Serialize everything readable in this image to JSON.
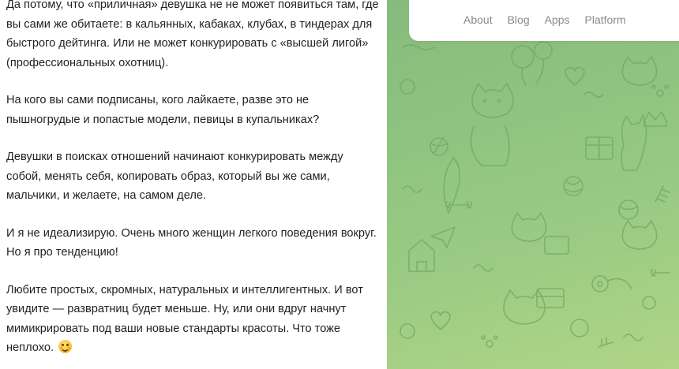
{
  "article": {
    "paragraphs": [
      "Да потому, что «приличная» девушка не не может появиться там, где вы сами же обитаете: в кальянных, кабаках, клубах, в тиндерах для быстрого дейтинга. Или не может конкурировать с «высшей лигой» (профессиональных охотниц).",
      "На кого вы сами подписаны, кого лайкаете, разве это не пышногрудые и попастые модели, певицы в купальниках?",
      "Девушки в поисках отношений начинают конкурировать между собой, менять себя, копировать образ, который вы же сами, мальчики, и желаете, на самом деле.",
      "И я не идеализирую. Очень много женщин легкого поведения вокруг. Но я про тенденцию!",
      "Любите простых, скромных, натуральных и интеллигентных. И вот увидите — развратниц будет меньше. Ну, или они вдруг начнут мимикрировать под ваши новые стандарты красоты. Что тоже неплохо."
    ],
    "last_paragraph_emoji": "blushing-smile-emoji"
  },
  "nav": {
    "items": [
      {
        "label": "About"
      },
      {
        "label": "Blog"
      },
      {
        "label": "Apps"
      },
      {
        "label": "Platform"
      }
    ]
  },
  "background": {
    "pattern": "doodle-pattern-cats-balloons",
    "colors": {
      "top": "#86bb7d",
      "bottom": "#b0d586",
      "doodle_stroke": "#6fa866"
    }
  }
}
